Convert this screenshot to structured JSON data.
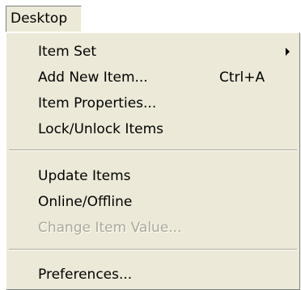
{
  "menubar": {
    "desktop_label": "Desktop"
  },
  "menu": {
    "items": [
      {
        "label": "Item Set",
        "has_submenu": true
      },
      {
        "label": "Add New Item...",
        "shortcut": "Ctrl+A"
      },
      {
        "label": "Item Properties..."
      },
      {
        "label": "Lock/Unlock Items"
      },
      {
        "label": "Update Items"
      },
      {
        "label": "Online/Offline"
      },
      {
        "label": "Change Item Value...",
        "disabled": true
      },
      {
        "label": "Preferences..."
      }
    ]
  },
  "colors": {
    "menu_background": "#ece9d8",
    "disabled_text": "#aca899"
  }
}
